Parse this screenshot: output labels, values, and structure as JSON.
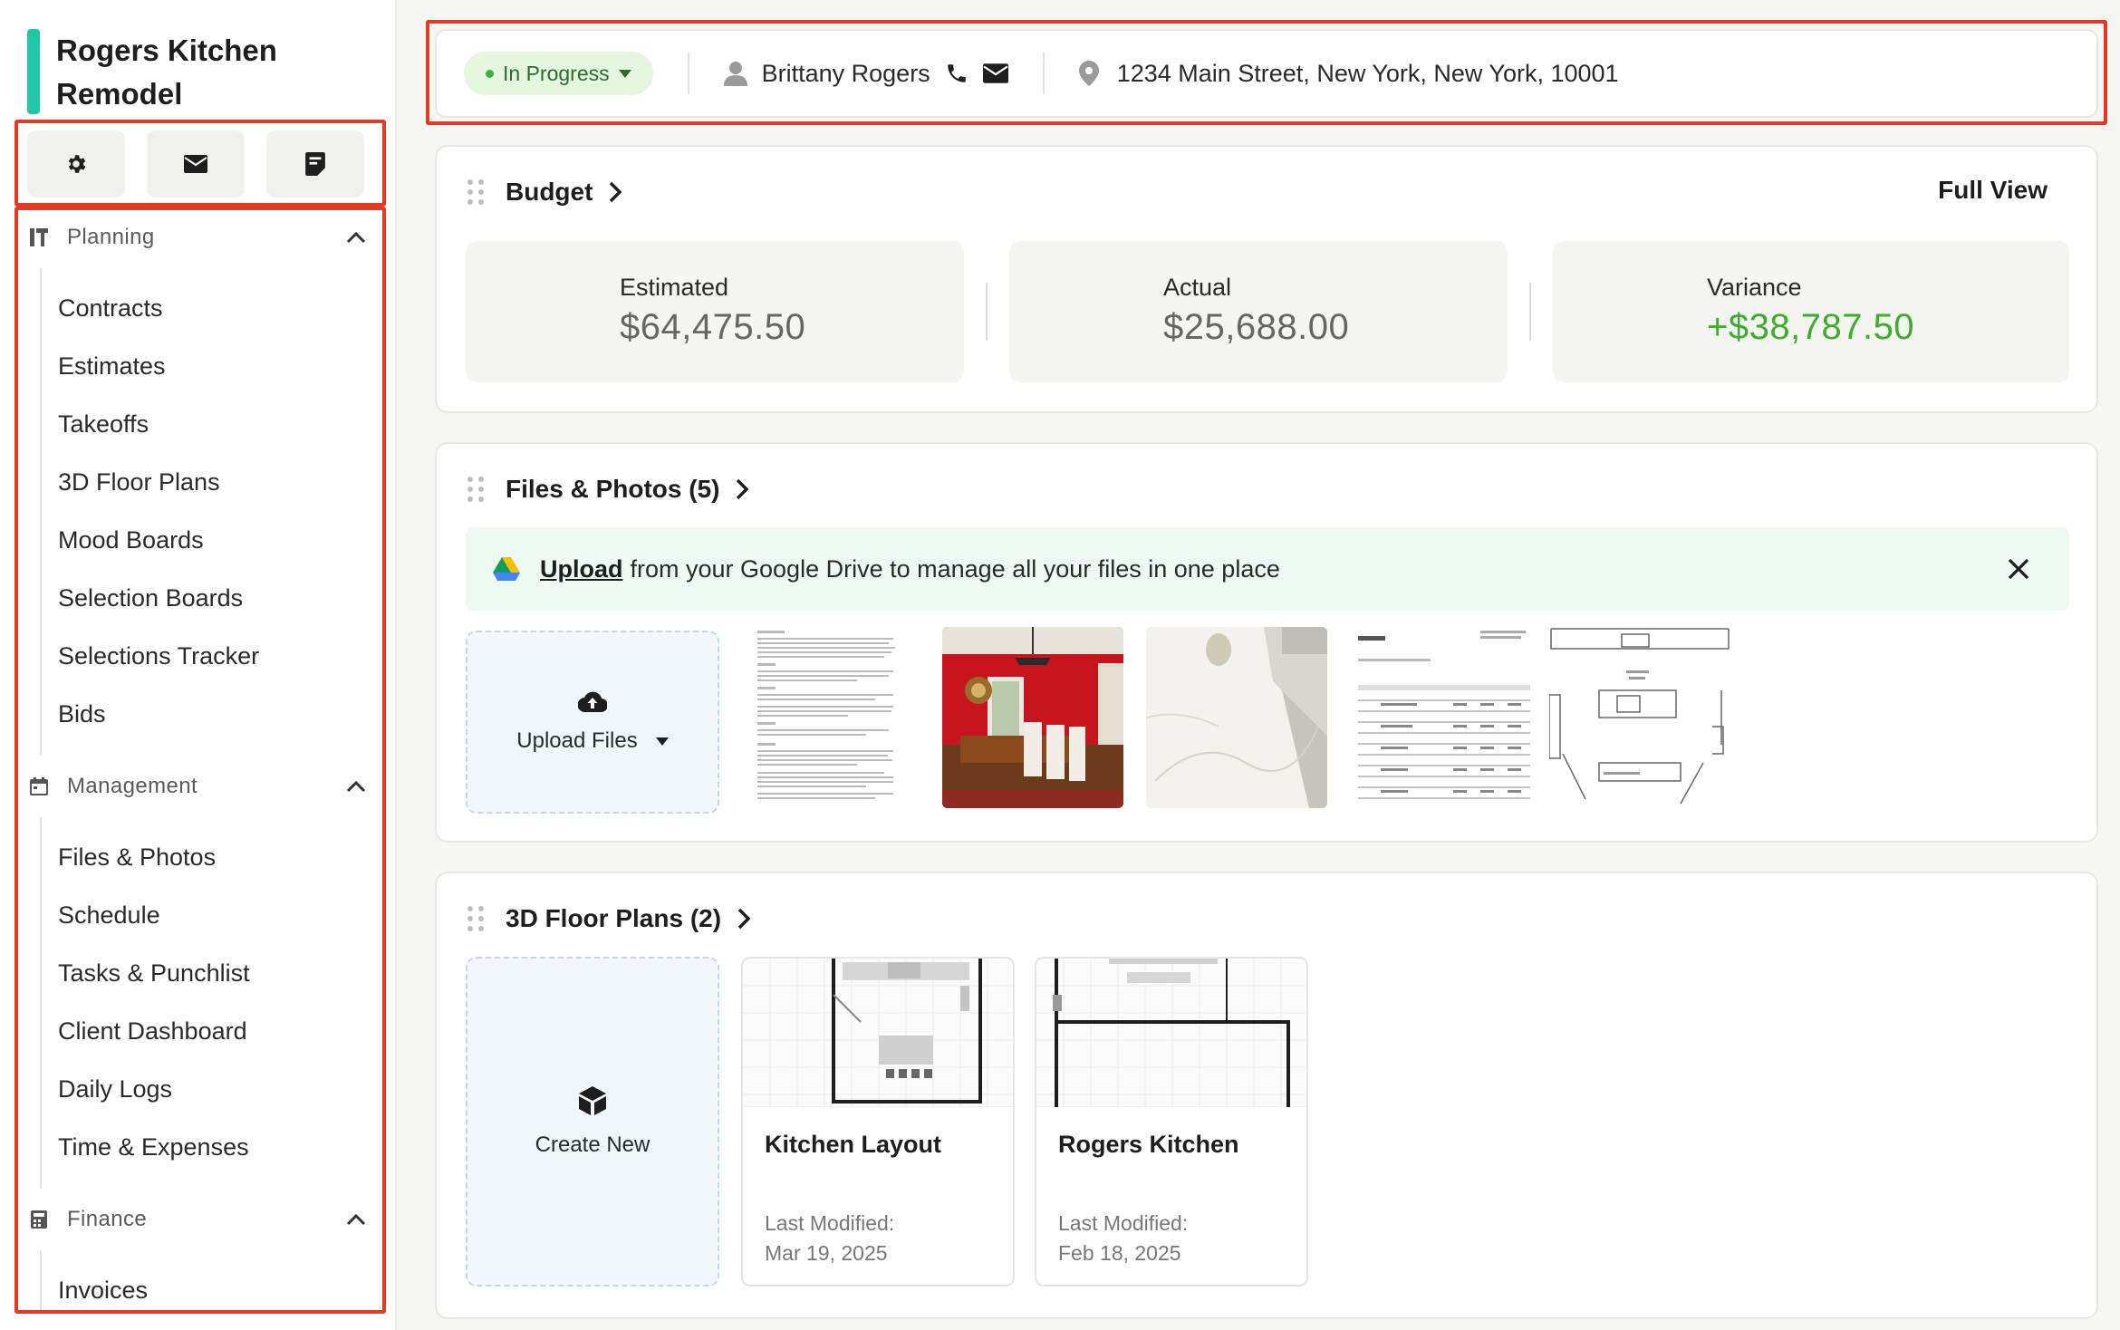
{
  "project": {
    "title": "Rogers Kitchen Remodel"
  },
  "quick_actions": [
    {
      "icon": "gear-icon"
    },
    {
      "icon": "mail-icon"
    },
    {
      "icon": "notes-icon"
    }
  ],
  "sidebar": {
    "groups": [
      {
        "label": "Planning",
        "icon": "planning-icon",
        "items": [
          "Contracts",
          "Estimates",
          "Takeoffs",
          "3D Floor Plans",
          "Mood Boards",
          "Selection Boards",
          "Selections Tracker",
          "Bids"
        ]
      },
      {
        "label": "Management",
        "icon": "calendar-icon",
        "items": [
          "Files & Photos",
          "Schedule",
          "Tasks & Punchlist",
          "Client Dashboard",
          "Daily Logs",
          "Time & Expenses"
        ]
      },
      {
        "label": "Finance",
        "icon": "calculator-icon",
        "items": [
          "Invoices"
        ]
      }
    ]
  },
  "topbar": {
    "status": "In Progress",
    "status_color": "#3db048",
    "client_name": "Brittany Rogers",
    "address": "1234 Main Street, New York, New York, 10001"
  },
  "budget": {
    "title": "Budget",
    "full_view": "Full View",
    "estimated_label": "Estimated",
    "estimated_value": "$64,475.50",
    "actual_label": "Actual",
    "actual_value": "$25,688.00",
    "variance_label": "Variance",
    "variance_value": "+$38,787.50",
    "variance_color": "#3dae2b"
  },
  "files": {
    "title": "Files & Photos (5)",
    "banner_link": "Upload",
    "banner_text": "from your Google Drive to manage all your files in one place",
    "upload_label": "Upload Files"
  },
  "floor_plans": {
    "title": "3D Floor Plans (2)",
    "create_label": "Create New",
    "modified_label": "Last Modified:",
    "plans": [
      {
        "name": "Kitchen Layout",
        "date": "Mar 19, 2025"
      },
      {
        "name": "Rogers Kitchen",
        "date": "Feb 18, 2025"
      }
    ]
  },
  "colors": {
    "accent": "#1fc7a7",
    "highlight": "#e23a25"
  }
}
